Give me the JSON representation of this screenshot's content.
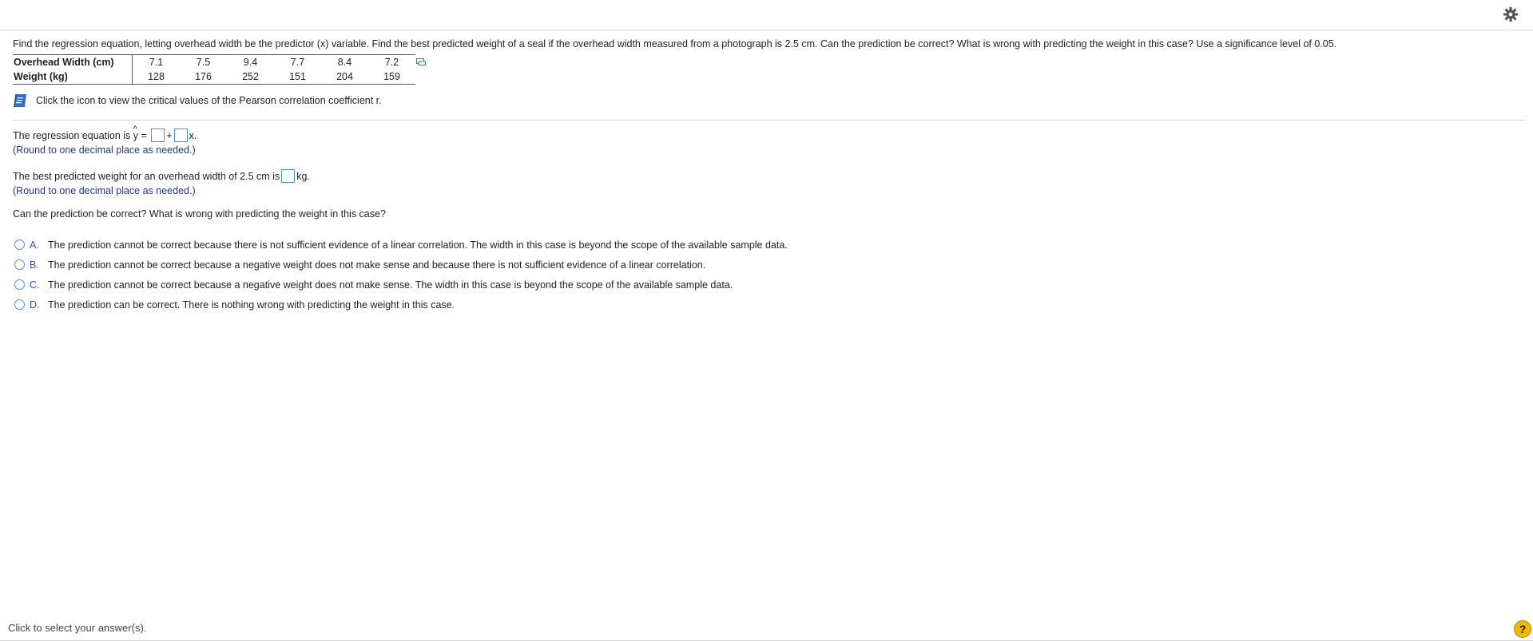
{
  "question": {
    "text": "Find the regression equation, letting overhead width be the predictor (x) variable. Find the best predicted weight of a seal if the overhead width measured from a photograph is 2.5 cm. Can the prediction be correct? What is wrong with predicting the weight in this case? Use a significance level of 0.05."
  },
  "table": {
    "rows": [
      {
        "label": "Overhead Width (cm)",
        "values": [
          "7.1",
          "7.5",
          "9.4",
          "7.7",
          "8.4",
          "7.2"
        ]
      },
      {
        "label": "Weight (kg)",
        "values": [
          "128",
          "176",
          "252",
          "151",
          "204",
          "159"
        ]
      }
    ]
  },
  "hint": {
    "text": "Click the icon to view the critical values of the Pearson correlation coefficient r."
  },
  "part1": {
    "prefix": "The regression equation is ",
    "yhat": "y",
    "equals": " = ",
    "plus": "+",
    "suffix": "x.",
    "note": "(Round to one decimal place as needed.)"
  },
  "part2": {
    "prefix": "The best predicted weight for an overhead width of 2.5 cm is",
    "suffix": "kg.",
    "note": "(Round to one decimal place as needed.)"
  },
  "part3": {
    "prompt": "Can the prediction be correct? What is wrong with predicting the weight in this case?"
  },
  "options": [
    {
      "letter": "A.",
      "text": "The prediction cannot be correct because there is not sufficient evidence of a linear correlation. The width in this case is beyond the scope of the available sample data."
    },
    {
      "letter": "B.",
      "text": "The prediction cannot be correct because a negative weight does not make sense and because there is not sufficient evidence of a linear correlation."
    },
    {
      "letter": "C.",
      "text": "The prediction cannot be correct because a negative weight does not make sense. The width in this case is beyond the scope of the available sample data."
    },
    {
      "letter": "D.",
      "text": "The prediction can be correct. There is nothing wrong with predicting the weight in this case."
    }
  ],
  "footer": {
    "text": "Click to select your answer(s).",
    "help": "?"
  },
  "icons": {
    "settings": "gear-icon",
    "copy": "copy-icon",
    "book": "book-icon",
    "help": "help-icon"
  },
  "colors": {
    "accent": "#2a5cb0",
    "note": "#1e3a8a",
    "help": "#f2b600",
    "input_border": "#4a90d9"
  }
}
